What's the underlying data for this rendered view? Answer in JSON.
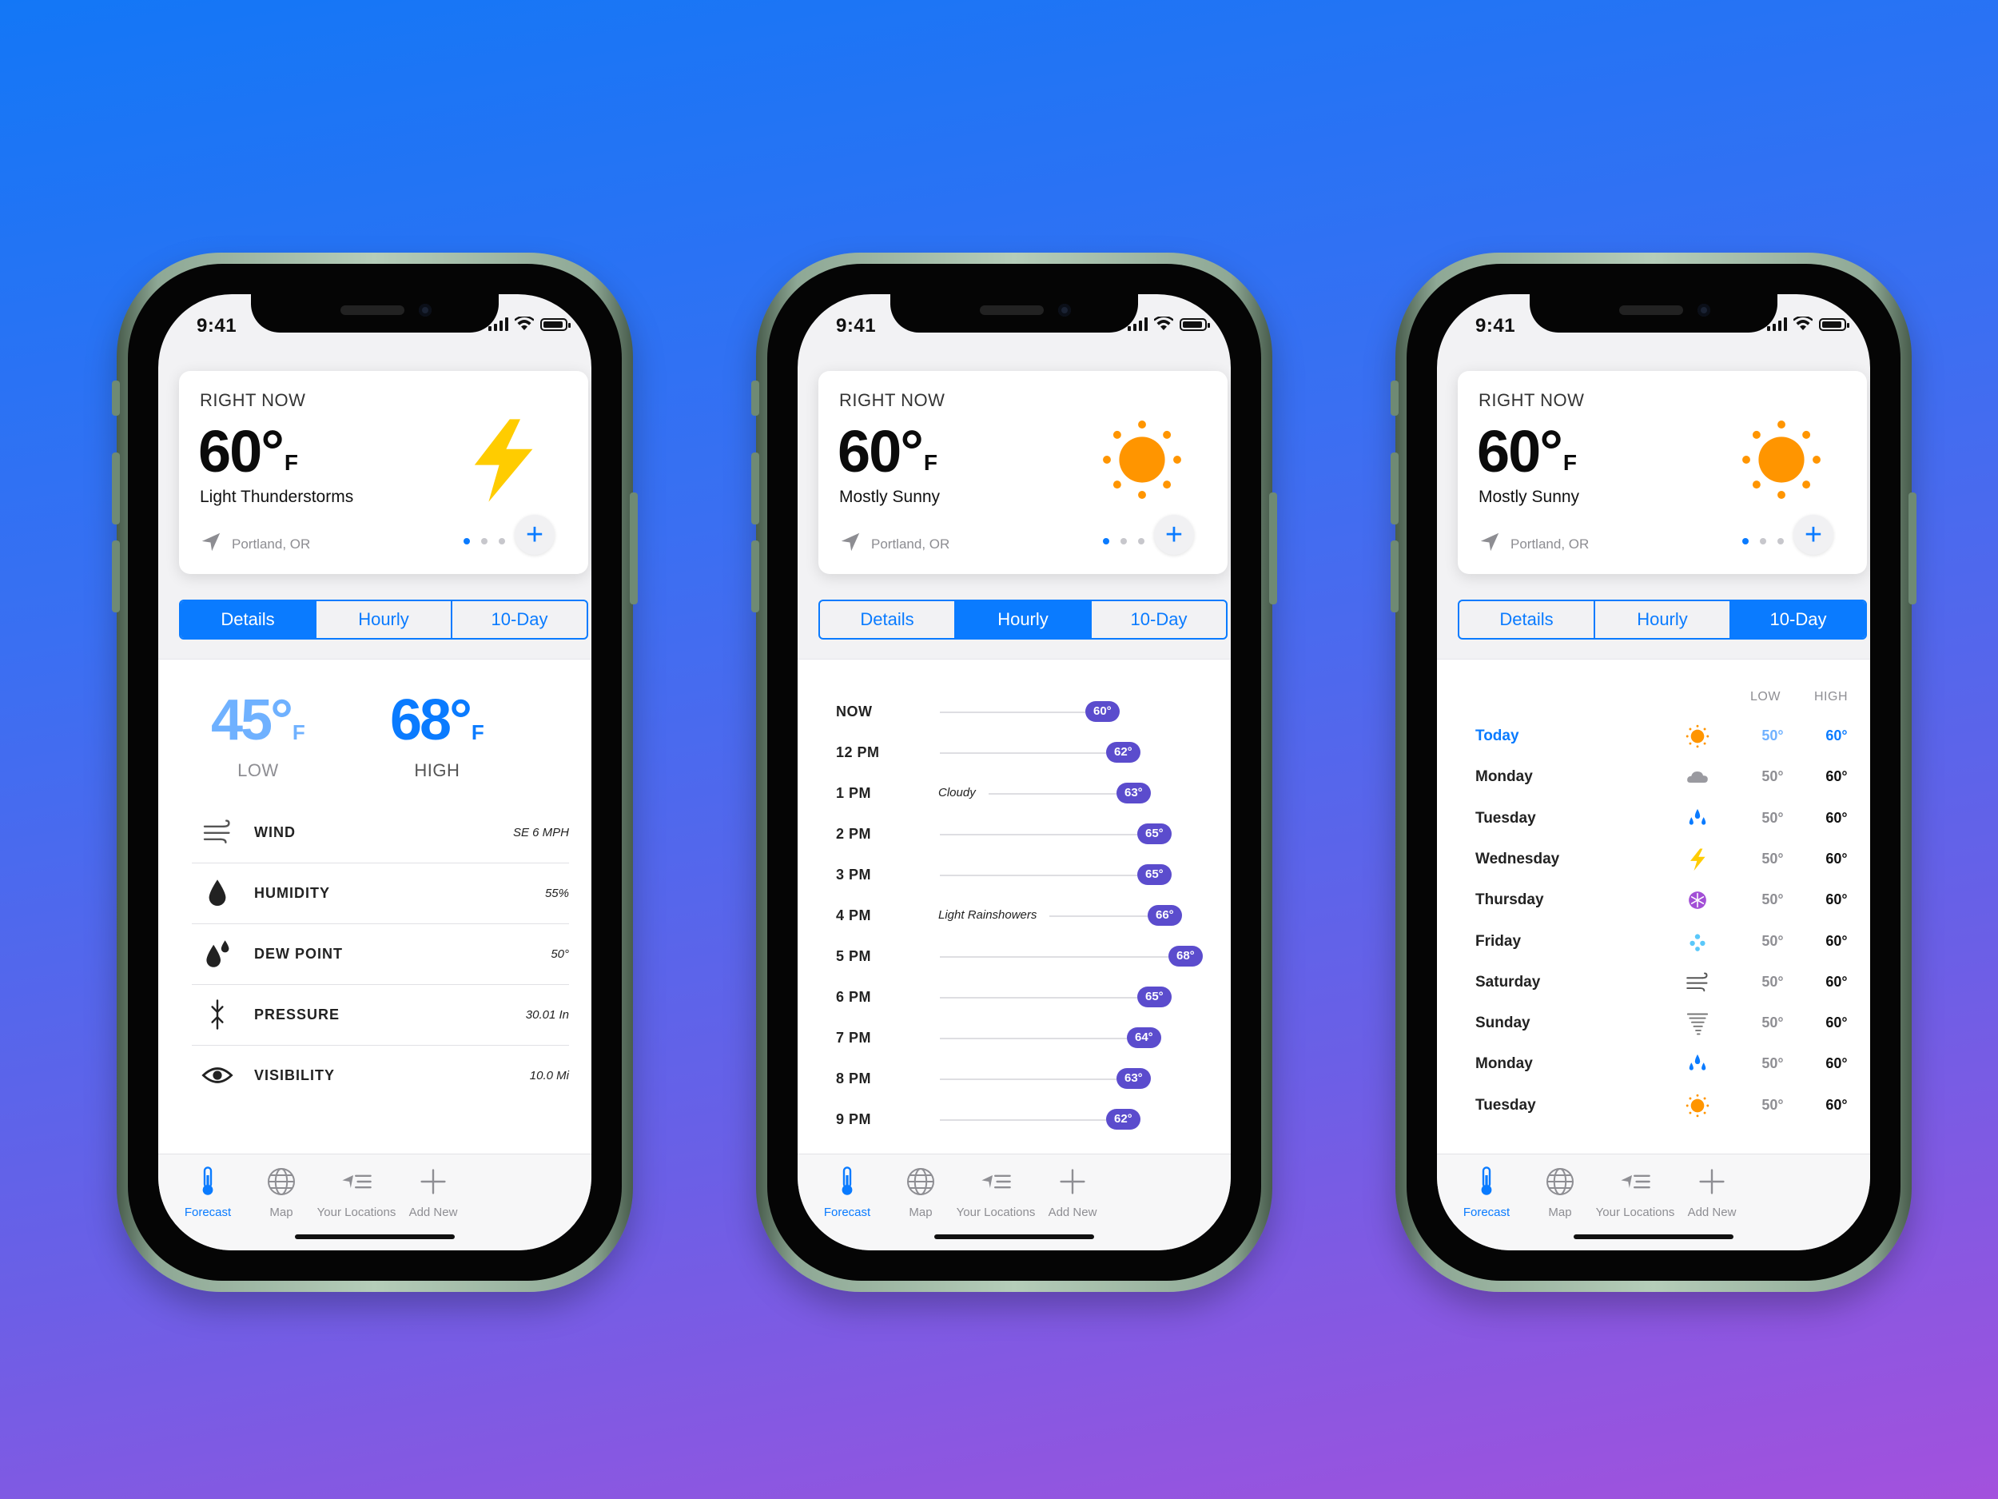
{
  "colors": {
    "accent": "#0a7bff",
    "pill": "#5b4ccd",
    "sun": "#ff9500",
    "bolt": "#ffcc00"
  },
  "status": {
    "time": "9:41"
  },
  "card_common": {
    "right_now": "RIGHT NOW",
    "temp": "60°",
    "unit": "F",
    "location": "Portland, OR",
    "add_icon": "plus-icon",
    "location_icon": "location-arrow-icon"
  },
  "phones": [
    {
      "condition": "Light Thunderstorms",
      "icon": "lightning-icon",
      "active_tab": "Details"
    },
    {
      "condition": "Mostly Sunny",
      "icon": "sun-icon",
      "active_tab": "Hourly"
    },
    {
      "condition": "Mostly Sunny",
      "icon": "sun-icon",
      "active_tab": "10-Day"
    }
  ],
  "tabs": [
    "Details",
    "Hourly",
    "10-Day"
  ],
  "details": {
    "low": {
      "value": "45°",
      "unit": "F",
      "label": "LOW"
    },
    "high": {
      "value": "68°",
      "unit": "F",
      "label": "HIGH"
    },
    "rows": [
      {
        "label": "WIND",
        "value": "SE 6 MPH",
        "icon": "wind-icon"
      },
      {
        "label": "HUMIDITY",
        "value": "55%",
        "icon": "drop-icon"
      },
      {
        "label": "DEW POINT",
        "value": "50°",
        "icon": "dew-point-icon"
      },
      {
        "label": "PRESSURE",
        "value": "30.01 In",
        "icon": "pressure-icon"
      },
      {
        "label": "VISIBILITY",
        "value": "10.0 Mi",
        "icon": "eye-icon"
      }
    ]
  },
  "hourly": [
    {
      "time": "NOW",
      "temp": "60°",
      "note": ""
    },
    {
      "time": "12 PM",
      "temp": "62°",
      "note": ""
    },
    {
      "time": "1 PM",
      "temp": "63°",
      "note": "Cloudy"
    },
    {
      "time": "2 PM",
      "temp": "65°",
      "note": ""
    },
    {
      "time": "3 PM",
      "temp": "65°",
      "note": ""
    },
    {
      "time": "4 PM",
      "temp": "66°",
      "note": "Light Rainshowers"
    },
    {
      "time": "5 PM",
      "temp": "68°",
      "note": ""
    },
    {
      "time": "6 PM",
      "temp": "65°",
      "note": ""
    },
    {
      "time": "7 PM",
      "temp": "64°",
      "note": ""
    },
    {
      "time": "8 PM",
      "temp": "63°",
      "note": ""
    },
    {
      "time": "9 PM",
      "temp": "62°",
      "note": ""
    }
  ],
  "ten_day": {
    "low_header": "LOW",
    "high_header": "HIGH",
    "rows": [
      {
        "day": "Today",
        "low": "50°",
        "high": "60°",
        "icon": "sun-icon"
      },
      {
        "day": "Monday",
        "low": "50°",
        "high": "60°",
        "icon": "cloud-icon"
      },
      {
        "day": "Tuesday",
        "low": "50°",
        "high": "60°",
        "icon": "rain-drops-icon"
      },
      {
        "day": "Wednesday",
        "low": "50°",
        "high": "60°",
        "icon": "lightning-icon"
      },
      {
        "day": "Thursday",
        "low": "50°",
        "high": "60°",
        "icon": "snowflake-icon"
      },
      {
        "day": "Friday",
        "low": "50°",
        "high": "60°",
        "icon": "hail-icon"
      },
      {
        "day": "Saturday",
        "low": "50°",
        "high": "60°",
        "icon": "wind-icon"
      },
      {
        "day": "Sunday",
        "low": "50°",
        "high": "60°",
        "icon": "tornado-icon"
      },
      {
        "day": "Monday",
        "low": "50°",
        "high": "60°",
        "icon": "rain-drops-icon"
      },
      {
        "day": "Tuesday",
        "low": "50°",
        "high": "60°",
        "icon": "sun-icon"
      }
    ]
  },
  "tabbar": [
    {
      "label": "Forecast",
      "icon": "thermometer-icon"
    },
    {
      "label": "Map",
      "icon": "globe-icon"
    },
    {
      "label": "Your Locations",
      "icon": "locations-list-icon"
    },
    {
      "label": "Add New",
      "icon": "plus-icon"
    }
  ]
}
